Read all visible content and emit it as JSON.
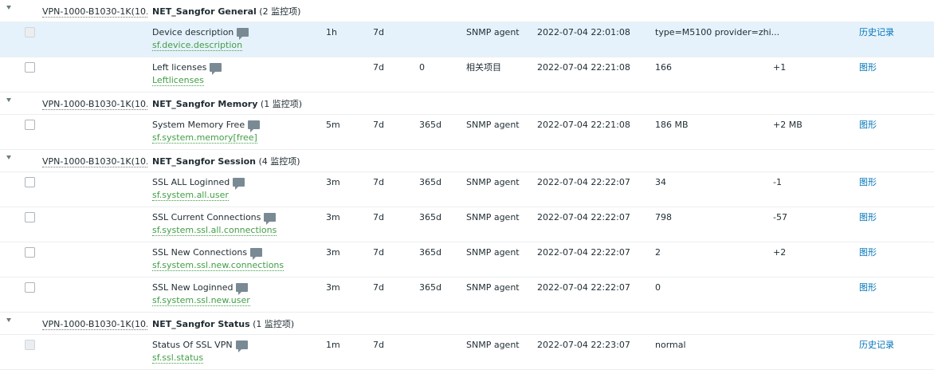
{
  "groups": [
    {
      "host": "VPN-1000-B1030-1K(10...",
      "app": "NET_Sangfor General",
      "count": "(2 监控项)",
      "items": [
        {
          "name": "Device description",
          "key": "sf.device.description",
          "interval": "1h",
          "history": "7d",
          "trends": "",
          "type": "SNMP agent",
          "last_check": "2022-07-04 22:01:08",
          "last_value": "type=M5100 provider=zhi...",
          "change": "",
          "action": "历史记录",
          "disabled": true,
          "highlight": true
        },
        {
          "name": "Left licenses",
          "key": "Leftlicenses",
          "interval": "",
          "history": "7d",
          "trends": "0",
          "type": "相关项目",
          "last_check": "2022-07-04 22:21:08",
          "last_value": "166",
          "change": "+1",
          "action": "图形",
          "disabled": false,
          "highlight": false
        }
      ]
    },
    {
      "host": "VPN-1000-B1030-1K(10...",
      "app": "NET_Sangfor Memory",
      "count": "(1 监控项)",
      "items": [
        {
          "name": "System Memory Free",
          "key": "sf.system.memory[free]",
          "interval": "5m",
          "history": "7d",
          "trends": "365d",
          "type": "SNMP agent",
          "last_check": "2022-07-04 22:21:08",
          "last_value": "186 MB",
          "change": "+2 MB",
          "action": "图形",
          "disabled": false,
          "highlight": false
        }
      ]
    },
    {
      "host": "VPN-1000-B1030-1K(10...",
      "app": "NET_Sangfor Session",
      "count": "(4 监控项)",
      "items": [
        {
          "name": "SSL ALL Loginned",
          "key": "sf.system.all.user",
          "interval": "3m",
          "history": "7d",
          "trends": "365d",
          "type": "SNMP agent",
          "last_check": "2022-07-04 22:22:07",
          "last_value": "34",
          "change": "-1",
          "action": "图形",
          "disabled": false,
          "highlight": false
        },
        {
          "name": "SSL Current Connections",
          "key": "sf.system.ssl.all.connections",
          "interval": "3m",
          "history": "7d",
          "trends": "365d",
          "type": "SNMP agent",
          "last_check": "2022-07-04 22:22:07",
          "last_value": "798",
          "change": "-57",
          "action": "图形",
          "disabled": false,
          "highlight": false
        },
        {
          "name": "SSL New Connections",
          "key": "sf.system.ssl.new.connections",
          "interval": "3m",
          "history": "7d",
          "trends": "365d",
          "type": "SNMP agent",
          "last_check": "2022-07-04 22:22:07",
          "last_value": "2",
          "change": "+2",
          "action": "图形",
          "disabled": false,
          "highlight": false
        },
        {
          "name": "SSL New Loginned",
          "key": "sf.system.ssl.new.user",
          "interval": "3m",
          "history": "7d",
          "trends": "365d",
          "type": "SNMP agent",
          "last_check": "2022-07-04 22:22:07",
          "last_value": "0",
          "change": "",
          "action": "图形",
          "disabled": false,
          "highlight": false
        }
      ]
    },
    {
      "host": "VPN-1000-B1030-1K(10...",
      "app": "NET_Sangfor Status",
      "count": "(1 监控项)",
      "items": [
        {
          "name": "Status Of SSL VPN",
          "key": "sf.ssl.status",
          "interval": "1m",
          "history": "7d",
          "trends": "",
          "type": "SNMP agent",
          "last_check": "2022-07-04 22:23:07",
          "last_value": "normal",
          "change": "",
          "action": "历史记录",
          "disabled": true,
          "highlight": false
        }
      ]
    }
  ]
}
